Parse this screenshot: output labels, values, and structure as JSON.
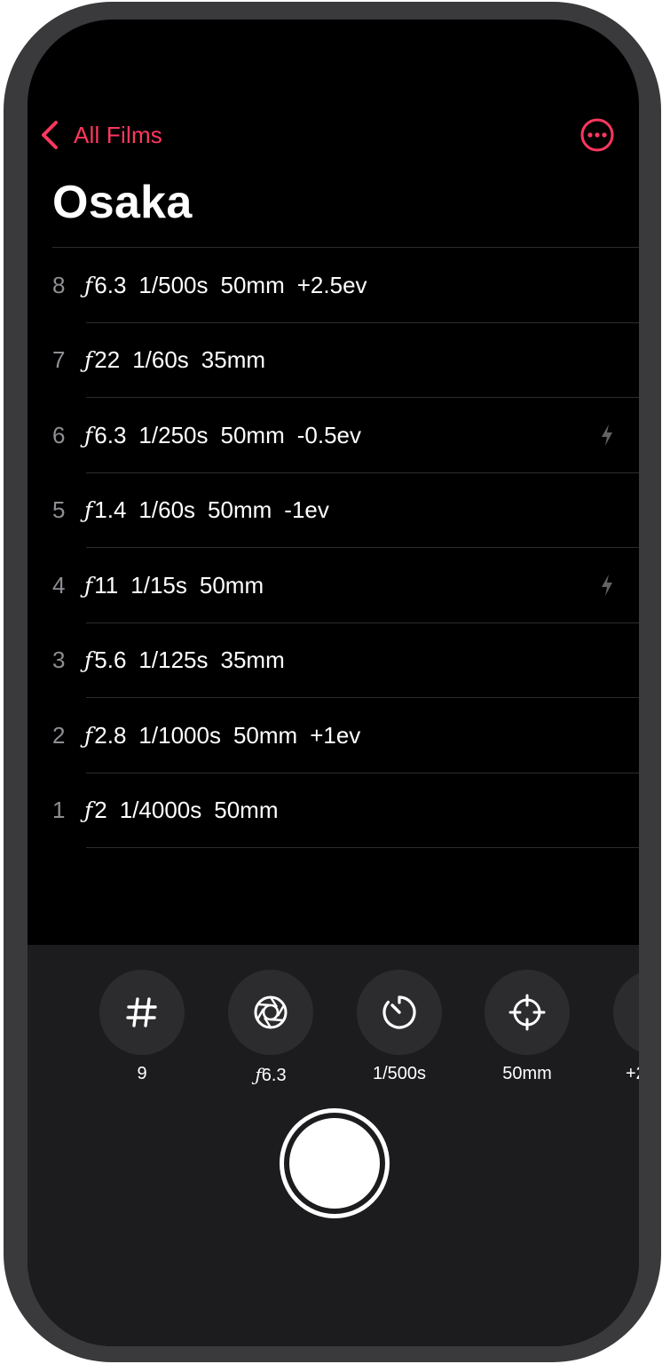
{
  "nav": {
    "back_label": "All Films"
  },
  "title": "Osaka",
  "frames": [
    {
      "number": "8",
      "aperture": "6.3",
      "shutter": "1/500s",
      "focal": "50mm",
      "ev": "+2.5ev",
      "flash": false
    },
    {
      "number": "7",
      "aperture": "22",
      "shutter": "1/60s",
      "focal": "35mm",
      "ev": "",
      "flash": false
    },
    {
      "number": "6",
      "aperture": "6.3",
      "shutter": "1/250s",
      "focal": "50mm",
      "ev": "-0.5ev",
      "flash": true
    },
    {
      "number": "5",
      "aperture": "1.4",
      "shutter": "1/60s",
      "focal": "50mm",
      "ev": "-1ev",
      "flash": false
    },
    {
      "number": "4",
      "aperture": "11",
      "shutter": "1/15s",
      "focal": "50mm",
      "ev": "",
      "flash": true
    },
    {
      "number": "3",
      "aperture": "5.6",
      "shutter": "1/125s",
      "focal": "35mm",
      "ev": "",
      "flash": false
    },
    {
      "number": "2",
      "aperture": "2.8",
      "shutter": "1/1000s",
      "focal": "50mm",
      "ev": "+1ev",
      "flash": false
    },
    {
      "number": "1",
      "aperture": "2",
      "shutter": "1/4000s",
      "focal": "50mm",
      "ev": "",
      "flash": false
    }
  ],
  "controls": {
    "frame_number": "9",
    "aperture": "6.3",
    "shutter": "1/500s",
    "focal": "50mm",
    "ev_partial": "+2"
  },
  "aperture_symbol": "ƒ",
  "colors": {
    "accent": "#ff375f",
    "background": "#000000",
    "panel": "#1c1c1e",
    "secondary_text": "#8e8e93"
  },
  "icons": [
    "chevron-left-icon",
    "more-icon",
    "flash-icon",
    "hash-icon",
    "aperture-icon",
    "timer-icon",
    "crosshair-icon",
    "shutter-button"
  ]
}
